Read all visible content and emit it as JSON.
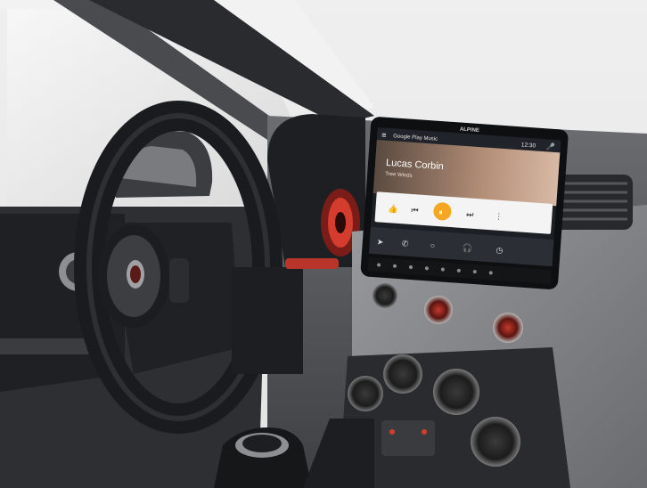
{
  "head_unit": {
    "brand": "ALPINE",
    "app_title": "Google Play Music",
    "clock": "12:30",
    "track_title": "Lucas Corbin",
    "track_subtitle": "Tree Winds"
  },
  "colors": {
    "accent": "#f5a623",
    "screen_dark": "#1c1f24",
    "nav_bar": "#2b2e35",
    "card": "#f4f4f4",
    "dashboard": "#5a5b5e"
  }
}
